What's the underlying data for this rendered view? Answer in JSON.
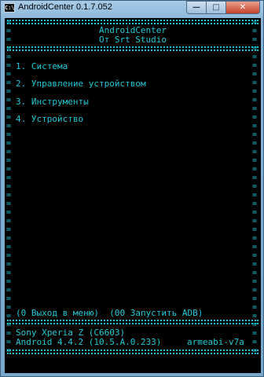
{
  "window": {
    "title": "AndroidCenter 0.1.7.052",
    "icon_text": "C:\\",
    "minimize_glyph": "—",
    "maximize_glyph": "□",
    "close_glyph": "✕"
  },
  "console": {
    "header": {
      "app_name": "AndroidCenter",
      "studio": "От Srt Studio"
    },
    "menu": [
      {
        "label": "1. Система"
      },
      {
        "label": "2. Управление устройством"
      },
      {
        "label": "3. Инструменты"
      },
      {
        "label": "4. Устройство"
      }
    ],
    "hint": "(0 Выход в меню)  (00 Запустить ADB)",
    "device": {
      "model": "Sony Xperia Z (C6603)",
      "android": "Android 4.4.2 (10.5.A.0.233)",
      "abi": "armeabi-v7a"
    },
    "colors": {
      "text": "#1ec8d6",
      "background": "#000000"
    }
  }
}
